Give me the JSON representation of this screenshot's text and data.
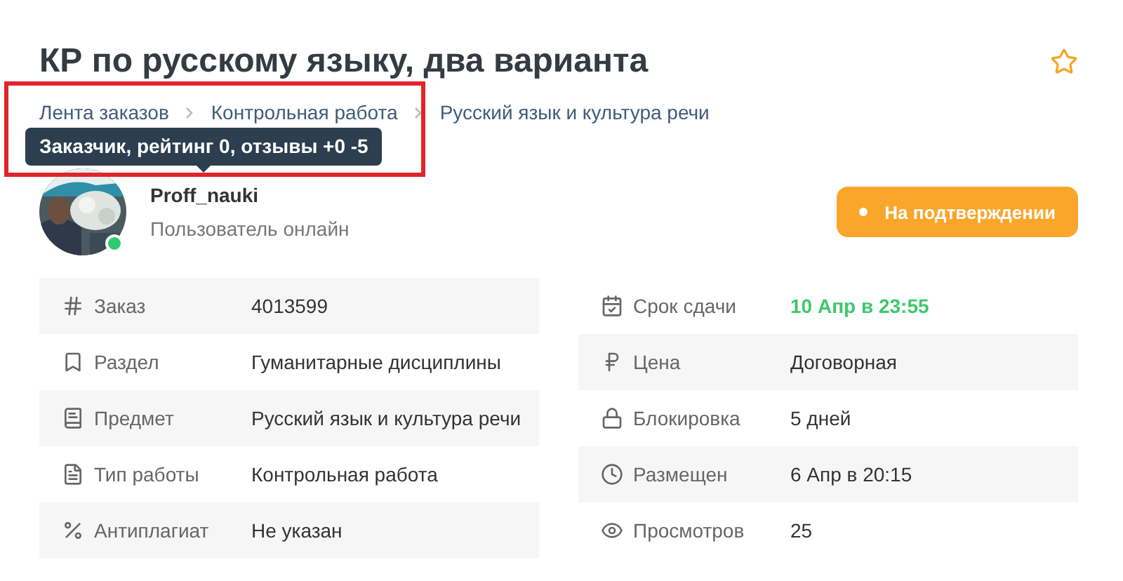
{
  "title": "КР по русскому языку, два варианта",
  "favorite": false,
  "breadcrumbs": [
    "Лента заказов",
    "Контрольная работа",
    "Русский язык и культура речи"
  ],
  "tooltip": "Заказчик, рейтинг 0, отзывы +0 -5",
  "user": {
    "name": "Proff_nauki",
    "status": "Пользователь онлайн",
    "online": true
  },
  "status_button": "На подтверждении",
  "details_left": [
    {
      "label": "Заказ",
      "value": "4013599",
      "accent": false
    },
    {
      "label": "Раздел",
      "value": "Гуманитарные дисциплины",
      "accent": false
    },
    {
      "label": "Предмет",
      "value": "Русский язык и культура речи",
      "accent": false
    },
    {
      "label": "Тип работы",
      "value": "Контрольная работа",
      "accent": false
    },
    {
      "label": "Антиплагиат",
      "value": "Не указан",
      "accent": false
    }
  ],
  "details_right": [
    {
      "label": "Срок сдачи",
      "value": "10 Апр в 23:55",
      "accent": true
    },
    {
      "label": "Цена",
      "value": "Договорная",
      "accent": false
    },
    {
      "label": "Блокировка",
      "value": "5 дней",
      "accent": false
    },
    {
      "label": "Размещен",
      "value": "6 Апр в 20:15",
      "accent": false
    },
    {
      "label": "Просмотров",
      "value": "25",
      "accent": false
    }
  ],
  "highlight_frame": true
}
